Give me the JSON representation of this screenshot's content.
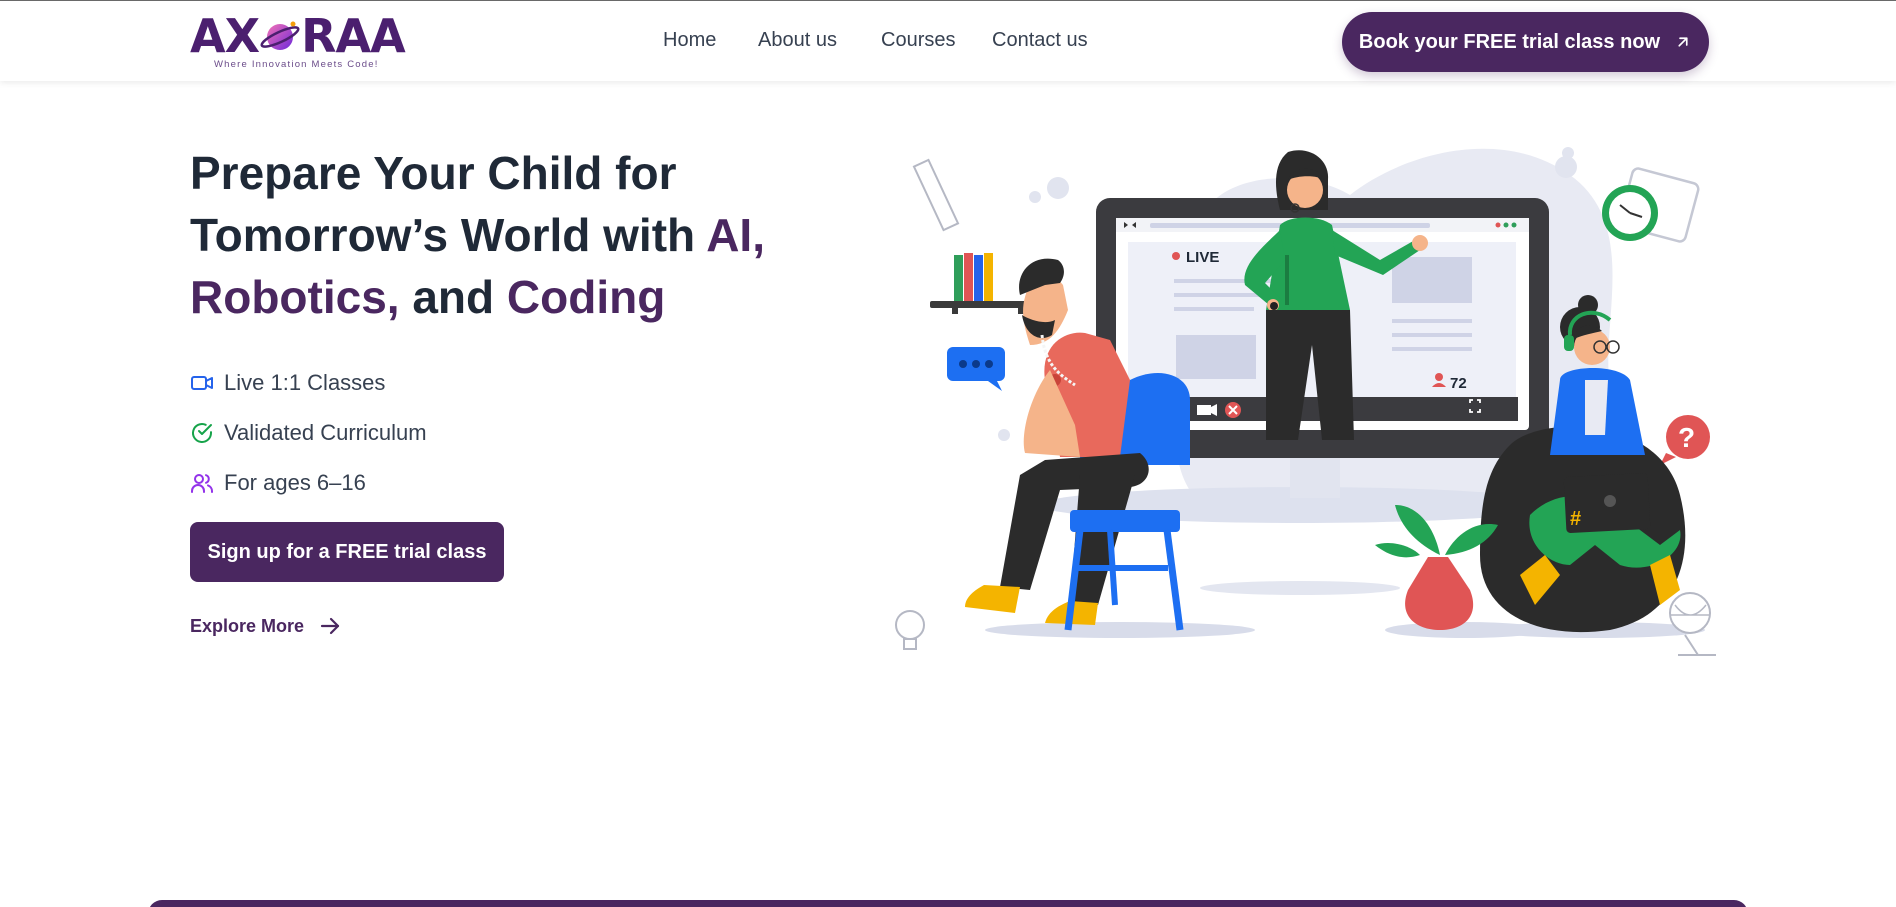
{
  "brand": {
    "name_prefix": "AX",
    "name_suffix": "RAA",
    "tagline": "Where Innovation Meets Code!",
    "color": "#4a2760"
  },
  "nav": {
    "items": [
      "Home",
      "About us",
      "Courses",
      "Contact us"
    ]
  },
  "header_cta": {
    "label": "Book your FREE trial class now",
    "icon": "arrow-up-right-icon"
  },
  "hero": {
    "title_part1": "Prepare Your Child for Tomorrow’s World with ",
    "title_ai": "AI,",
    "title_robotics": "Robotics,",
    "title_and": " and ",
    "title_coding": "Coding",
    "features": [
      {
        "label": "Live 1:1 Classes",
        "icon": "video-camera-icon",
        "color": "#2563eb"
      },
      {
        "label": "Validated Curriculum",
        "icon": "check-circle-icon",
        "color": "#16a34a"
      },
      {
        "label": "For ages 6–16",
        "icon": "users-icon",
        "color": "#9333ea"
      }
    ],
    "primary_cta": "Sign up for a FREE trial class",
    "secondary_link": "Explore More"
  },
  "illustration": {
    "live_label": "LIVE",
    "viewer_count": "72",
    "hash_symbol": "#",
    "question_symbol": "?"
  }
}
